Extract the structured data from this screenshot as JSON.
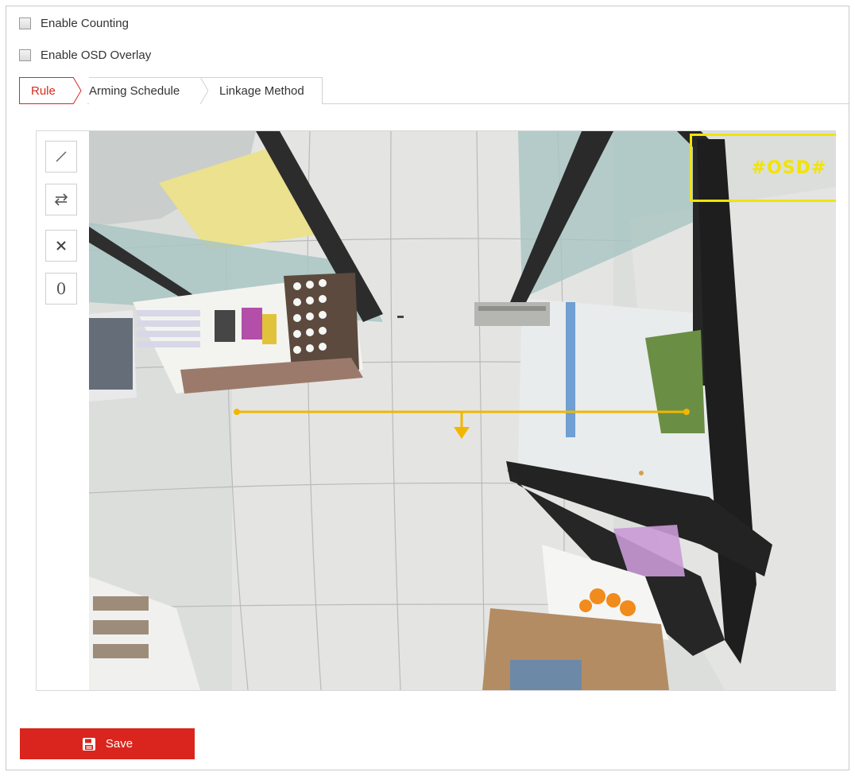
{
  "options": {
    "enable_counting": {
      "label": "Enable Counting",
      "checked": false
    },
    "enable_osd": {
      "label": "Enable OSD Overlay",
      "checked": false
    }
  },
  "tabs": [
    {
      "label": "Rule",
      "active": true
    },
    {
      "label": "Arming Schedule",
      "active": false
    },
    {
      "label": "Linkage Method",
      "active": false
    }
  ],
  "toolbar": {
    "draw_line_icon": "line-draw-icon",
    "swap_direction_icon": "swap-direction-icon",
    "clear_icon": "clear-icon",
    "counter_label": "0"
  },
  "video": {
    "osd_text": "#OSD#",
    "osd_color": "#f2e400",
    "line_color": "#f2b600"
  },
  "actions": {
    "save_label": "Save"
  },
  "colors": {
    "accent": "#d9251d"
  }
}
